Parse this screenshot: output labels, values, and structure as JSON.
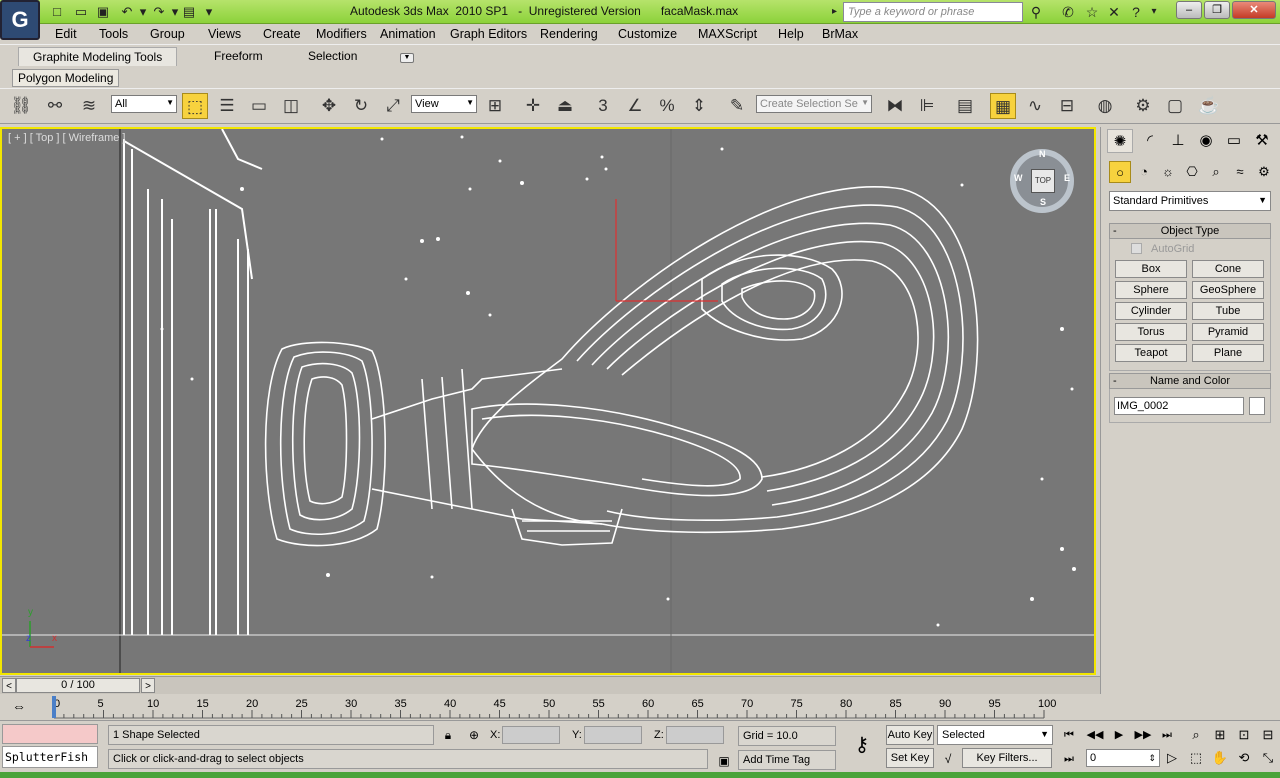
{
  "window": {
    "title": "Autodesk 3ds Max  2010 SP1   -  Unregistered Version      facaMask.max",
    "app_icon": "G",
    "search_placeholder": "Type a keyword or phrase"
  },
  "menu": [
    "Edit",
    "Tools",
    "Group",
    "Views",
    "Create",
    "Modifiers",
    "Animation",
    "Graph Editors",
    "Rendering",
    "Customize",
    "MAXScript",
    "Help",
    "BrMax"
  ],
  "ribbon": {
    "tabs": [
      "Graphite Modeling Tools",
      "Freeform",
      "Selection"
    ],
    "panel": "Polygon Modeling"
  },
  "toolbar": {
    "filter": "All",
    "ref_coord": "View",
    "named_selection": "Create Selection Se",
    "snap_label": "3"
  },
  "viewport": {
    "label": "[ + ] [ Top ] [ Wireframe ]",
    "viewcube": "TOP",
    "viewcube_dirs": {
      "n": "N",
      "s": "S",
      "e": "E",
      "w": "W"
    },
    "axis": {
      "y": "y",
      "z": "z",
      "x": "x"
    }
  },
  "command_panel": {
    "category": "Standard Primitives",
    "object_type_title": "Object Type",
    "autogrid": "AutoGrid",
    "primitives": [
      "Box",
      "Cone",
      "Sphere",
      "GeoSphere",
      "Cylinder",
      "Tube",
      "Torus",
      "Pyramid",
      "Teapot",
      "Plane"
    ],
    "name_color_title": "Name and Color",
    "object_name": "IMG_0002",
    "object_color": "#ffffff"
  },
  "timeline": {
    "frame_display": "0 / 100",
    "ticks": [
      "0",
      "5",
      "10",
      "15",
      "20",
      "25",
      "30",
      "35",
      "40",
      "45",
      "50",
      "55",
      "60",
      "65",
      "70",
      "75",
      "80",
      "85",
      "90",
      "95",
      "100"
    ]
  },
  "status": {
    "listener": "SplutterFish",
    "selection": "1 Shape Selected",
    "prompt": "Click or click-and-drag to select objects",
    "x_label": "X:",
    "y_label": "Y:",
    "z_label": "Z:",
    "grid": "Grid = 10.0",
    "add_time_tag": "Add Time Tag",
    "auto_key": "Auto Key",
    "set_key": "Set Key",
    "key_mode": "Selected",
    "key_filters": "Key Filters...",
    "frame": "0"
  },
  "colors": {
    "titlebar": "#8cd23a",
    "viewport_bg": "#777777",
    "viewport_border": "#f2e600",
    "active_tool": "#f7d23e"
  }
}
